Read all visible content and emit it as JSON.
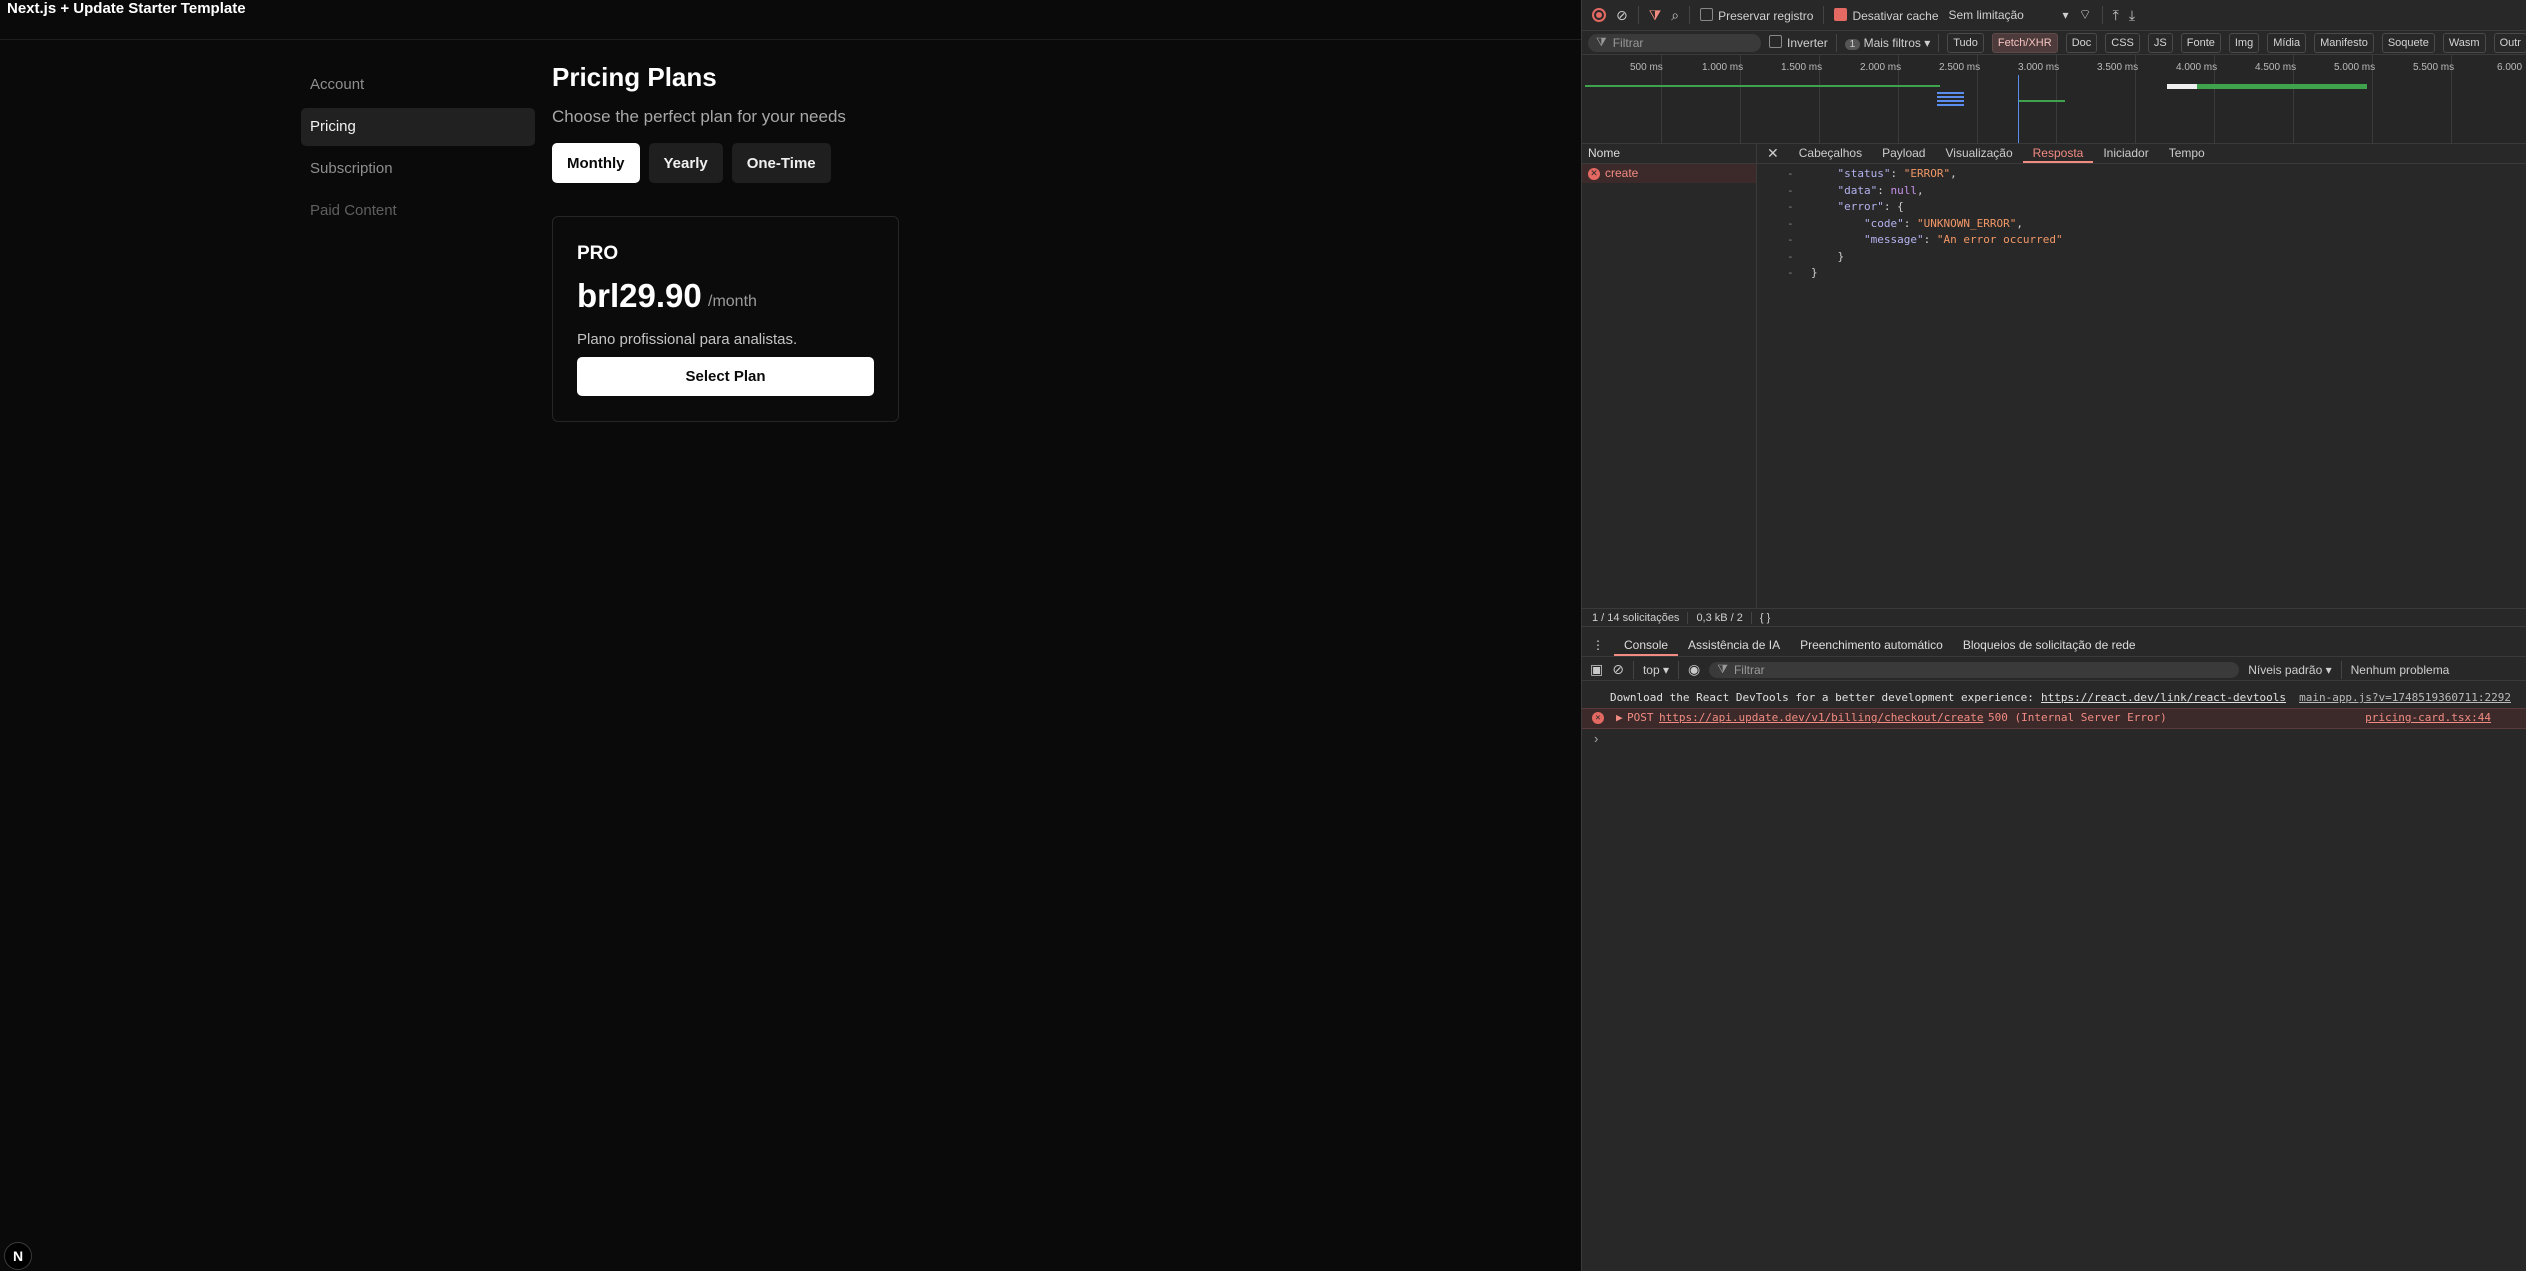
{
  "app": {
    "title": "Next.js + Update Starter Template",
    "nav": [
      {
        "label": "Account"
      },
      {
        "label": "Pricing"
      },
      {
        "label": "Subscription"
      },
      {
        "label": "Paid Content"
      }
    ],
    "page_title": "Pricing Plans",
    "page_subtitle": "Choose the perfect plan for your needs",
    "billing_tabs": [
      "Monthly",
      "Yearly",
      "One-Time"
    ],
    "active_billing_tab": "Monthly",
    "plan": {
      "name": "PRO",
      "price": "brl29.90",
      "period": "/month",
      "description": "Plano profissional para analistas.",
      "button": "Select Plan"
    },
    "next_badge": "N"
  },
  "devtools": {
    "toolbar": {
      "preserve_log": "Preservar registro",
      "disable_cache": "Desativar cache",
      "throttling": "Sem limitação"
    },
    "filterbar": {
      "filter_placeholder": "Filtrar",
      "invert": "Inverter",
      "more_filters_count": "1",
      "more_filters": "Mais filtros",
      "types": [
        "Tudo",
        "Fetch/XHR",
        "Doc",
        "CSS",
        "JS",
        "Fonte",
        "Img",
        "Mídia",
        "Manifesto",
        "Soquete",
        "Wasm",
        "Outr"
      ]
    },
    "timeline_ticks": [
      "500 ms",
      "1.000 ms",
      "1.500 ms",
      "2.000 ms",
      "2.500 ms",
      "3.000 ms",
      "3.500 ms",
      "4.000 ms",
      "4.500 ms",
      "5.000 ms",
      "5.500 ms",
      "6.000"
    ],
    "name_header": "Nome",
    "request_name": "create",
    "detail_tabs": [
      "Cabeçalhos",
      "Payload",
      "Visualização",
      "Resposta",
      "Iniciador",
      "Tempo"
    ],
    "response_lines": {
      "status_key": "\"status\"",
      "status_val": "\"ERROR\"",
      "data_key": "\"data\"",
      "data_val": "null",
      "error_key": "\"error\"",
      "code_key": "\"code\"",
      "code_val": "\"UNKNOWN_ERROR\"",
      "message_key": "\"message\"",
      "message_val": "\"An error occurred\""
    },
    "status": {
      "requests": "1 / 14 solicitações",
      "transferred": "0,3 kB / 2"
    },
    "drawer_tabs": [
      "Console",
      "Assistência de IA",
      "Preenchimento automático",
      "Bloqueios de solicitação de rede"
    ],
    "console": {
      "context": "top",
      "filter_placeholder": "Filtrar",
      "levels": "Níveis padrão",
      "issues": "Nenhum problema",
      "msg1_text": "Download the React DevTools for a better development experience:",
      "msg1_link": "https://react.dev/link/react-devtools",
      "msg1_source": "main-app.js?v=1748519360711:2292",
      "msg2_method": "POST",
      "msg2_url": "https://api.update.dev/v1/billing/checkout/create",
      "msg2_status": "500 (Internal Server Error)",
      "msg2_source": "pricing-card.tsx:44",
      "prompt": "›"
    }
  }
}
